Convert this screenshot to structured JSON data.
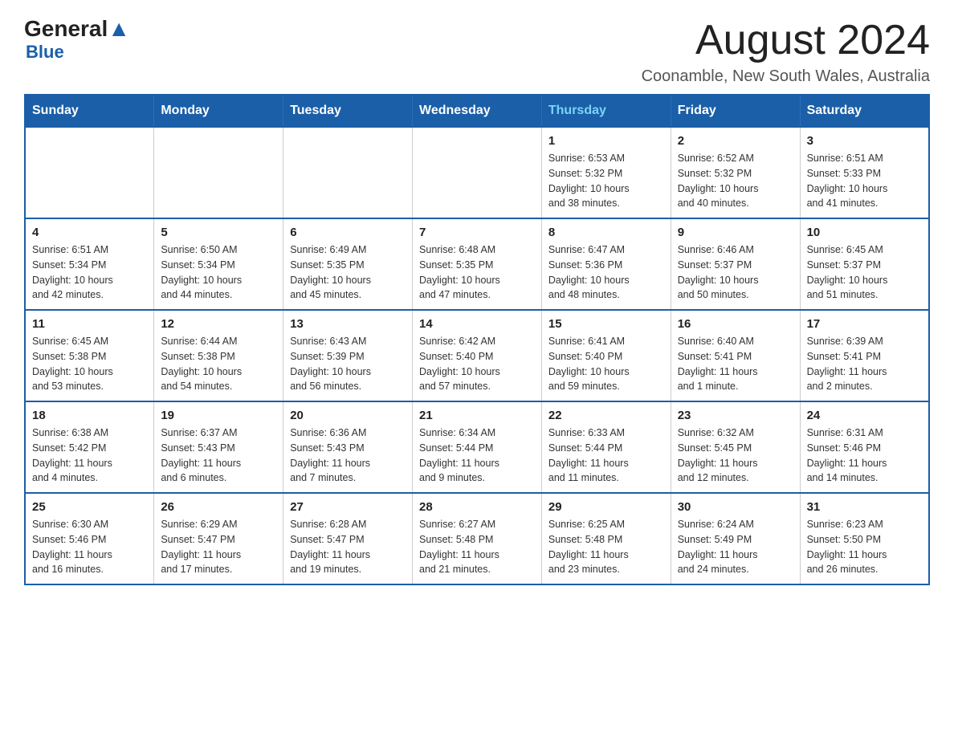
{
  "header": {
    "logo_general": "General",
    "logo_blue": "Blue",
    "main_title": "August 2024",
    "subtitle": "Coonamble, New South Wales, Australia"
  },
  "days_of_week": [
    "Sunday",
    "Monday",
    "Tuesday",
    "Wednesday",
    "Thursday",
    "Friday",
    "Saturday"
  ],
  "weeks": [
    [
      {
        "day": "",
        "info": ""
      },
      {
        "day": "",
        "info": ""
      },
      {
        "day": "",
        "info": ""
      },
      {
        "day": "",
        "info": ""
      },
      {
        "day": "1",
        "info": "Sunrise: 6:53 AM\nSunset: 5:32 PM\nDaylight: 10 hours\nand 38 minutes."
      },
      {
        "day": "2",
        "info": "Sunrise: 6:52 AM\nSunset: 5:32 PM\nDaylight: 10 hours\nand 40 minutes."
      },
      {
        "day": "3",
        "info": "Sunrise: 6:51 AM\nSunset: 5:33 PM\nDaylight: 10 hours\nand 41 minutes."
      }
    ],
    [
      {
        "day": "4",
        "info": "Sunrise: 6:51 AM\nSunset: 5:34 PM\nDaylight: 10 hours\nand 42 minutes."
      },
      {
        "day": "5",
        "info": "Sunrise: 6:50 AM\nSunset: 5:34 PM\nDaylight: 10 hours\nand 44 minutes."
      },
      {
        "day": "6",
        "info": "Sunrise: 6:49 AM\nSunset: 5:35 PM\nDaylight: 10 hours\nand 45 minutes."
      },
      {
        "day": "7",
        "info": "Sunrise: 6:48 AM\nSunset: 5:35 PM\nDaylight: 10 hours\nand 47 minutes."
      },
      {
        "day": "8",
        "info": "Sunrise: 6:47 AM\nSunset: 5:36 PM\nDaylight: 10 hours\nand 48 minutes."
      },
      {
        "day": "9",
        "info": "Sunrise: 6:46 AM\nSunset: 5:37 PM\nDaylight: 10 hours\nand 50 minutes."
      },
      {
        "day": "10",
        "info": "Sunrise: 6:45 AM\nSunset: 5:37 PM\nDaylight: 10 hours\nand 51 minutes."
      }
    ],
    [
      {
        "day": "11",
        "info": "Sunrise: 6:45 AM\nSunset: 5:38 PM\nDaylight: 10 hours\nand 53 minutes."
      },
      {
        "day": "12",
        "info": "Sunrise: 6:44 AM\nSunset: 5:38 PM\nDaylight: 10 hours\nand 54 minutes."
      },
      {
        "day": "13",
        "info": "Sunrise: 6:43 AM\nSunset: 5:39 PM\nDaylight: 10 hours\nand 56 minutes."
      },
      {
        "day": "14",
        "info": "Sunrise: 6:42 AM\nSunset: 5:40 PM\nDaylight: 10 hours\nand 57 minutes."
      },
      {
        "day": "15",
        "info": "Sunrise: 6:41 AM\nSunset: 5:40 PM\nDaylight: 10 hours\nand 59 minutes."
      },
      {
        "day": "16",
        "info": "Sunrise: 6:40 AM\nSunset: 5:41 PM\nDaylight: 11 hours\nand 1 minute."
      },
      {
        "day": "17",
        "info": "Sunrise: 6:39 AM\nSunset: 5:41 PM\nDaylight: 11 hours\nand 2 minutes."
      }
    ],
    [
      {
        "day": "18",
        "info": "Sunrise: 6:38 AM\nSunset: 5:42 PM\nDaylight: 11 hours\nand 4 minutes."
      },
      {
        "day": "19",
        "info": "Sunrise: 6:37 AM\nSunset: 5:43 PM\nDaylight: 11 hours\nand 6 minutes."
      },
      {
        "day": "20",
        "info": "Sunrise: 6:36 AM\nSunset: 5:43 PM\nDaylight: 11 hours\nand 7 minutes."
      },
      {
        "day": "21",
        "info": "Sunrise: 6:34 AM\nSunset: 5:44 PM\nDaylight: 11 hours\nand 9 minutes."
      },
      {
        "day": "22",
        "info": "Sunrise: 6:33 AM\nSunset: 5:44 PM\nDaylight: 11 hours\nand 11 minutes."
      },
      {
        "day": "23",
        "info": "Sunrise: 6:32 AM\nSunset: 5:45 PM\nDaylight: 11 hours\nand 12 minutes."
      },
      {
        "day": "24",
        "info": "Sunrise: 6:31 AM\nSunset: 5:46 PM\nDaylight: 11 hours\nand 14 minutes."
      }
    ],
    [
      {
        "day": "25",
        "info": "Sunrise: 6:30 AM\nSunset: 5:46 PM\nDaylight: 11 hours\nand 16 minutes."
      },
      {
        "day": "26",
        "info": "Sunrise: 6:29 AM\nSunset: 5:47 PM\nDaylight: 11 hours\nand 17 minutes."
      },
      {
        "day": "27",
        "info": "Sunrise: 6:28 AM\nSunset: 5:47 PM\nDaylight: 11 hours\nand 19 minutes."
      },
      {
        "day": "28",
        "info": "Sunrise: 6:27 AM\nSunset: 5:48 PM\nDaylight: 11 hours\nand 21 minutes."
      },
      {
        "day": "29",
        "info": "Sunrise: 6:25 AM\nSunset: 5:48 PM\nDaylight: 11 hours\nand 23 minutes."
      },
      {
        "day": "30",
        "info": "Sunrise: 6:24 AM\nSunset: 5:49 PM\nDaylight: 11 hours\nand 24 minutes."
      },
      {
        "day": "31",
        "info": "Sunrise: 6:23 AM\nSunset: 5:50 PM\nDaylight: 11 hours\nand 26 minutes."
      }
    ]
  ]
}
